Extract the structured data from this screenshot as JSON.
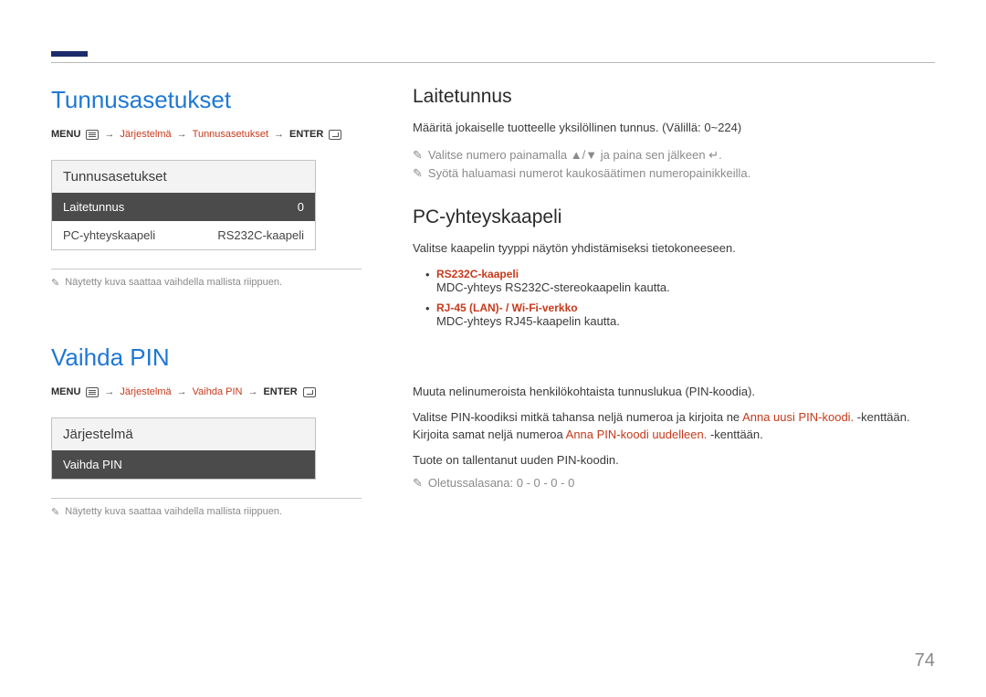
{
  "page_number": "74",
  "left": {
    "section1": {
      "title": "Tunnusasetukset",
      "breadcrumb": {
        "menu": "MENU",
        "seg1": "Järjestelmä",
        "seg2": "Tunnusasetukset",
        "enter": "ENTER"
      },
      "card": {
        "title": "Tunnusasetukset",
        "row1_label": "Laitetunnus",
        "row1_value": "0",
        "row2_label": "PC-yhteyskaapeli",
        "row2_value": "RS232C-kaapeli"
      },
      "note": "Näytetty kuva saattaa vaihdella mallista riippuen."
    },
    "section2": {
      "title": "Vaihda PIN",
      "breadcrumb": {
        "menu": "MENU",
        "seg1": "Järjestelmä",
        "seg2": "Vaihda PIN",
        "enter": "ENTER"
      },
      "card": {
        "title": "Järjestelmä",
        "row1_label": "Vaihda PIN"
      },
      "note": "Näytetty kuva saattaa vaihdella mallista riippuen."
    }
  },
  "right": {
    "sect1": {
      "h2": "Laitetunnus",
      "p1": "Määritä jokaiselle tuotteelle yksilöllinen tunnus. (Välillä: 0~224)",
      "n1": "Valitse numero painamalla ▲/▼ ja paina sen jälkeen ↵.",
      "n2": "Syötä haluamasi numerot kaukosäätimen numeropainikkeilla."
    },
    "sect2": {
      "h2": "PC-yhteyskaapeli",
      "p1": "Valitse kaapelin tyyppi näytön yhdistämiseksi tietokoneeseen.",
      "opt1_title": "RS232C-kaapeli",
      "opt1_desc": "MDC-yhteys RS232C-stereokaapelin kautta.",
      "opt2_title": "RJ-45 (LAN)- / Wi-Fi-verkko",
      "opt2_desc": "MDC-yhteys RJ45-kaapelin kautta."
    },
    "sect3": {
      "p1a": "Muuta nelinumeroista henkilökohtaista tunnuslukua (PIN-koodia).",
      "p2a": "Valitse PIN-koodiksi mitkä tahansa neljä numeroa ja kirjoita ne ",
      "p2b": "Anna uusi PIN-koodi.",
      "p2c": " -kenttään. Kirjoita samat neljä numeroa ",
      "p2d": "Anna PIN-koodi uudelleen.",
      "p2e": " -kenttään.",
      "p3": "Tuote on tallentanut uuden PIN-koodin.",
      "n1": "Oletussalasana: 0 - 0 - 0 - 0"
    }
  }
}
